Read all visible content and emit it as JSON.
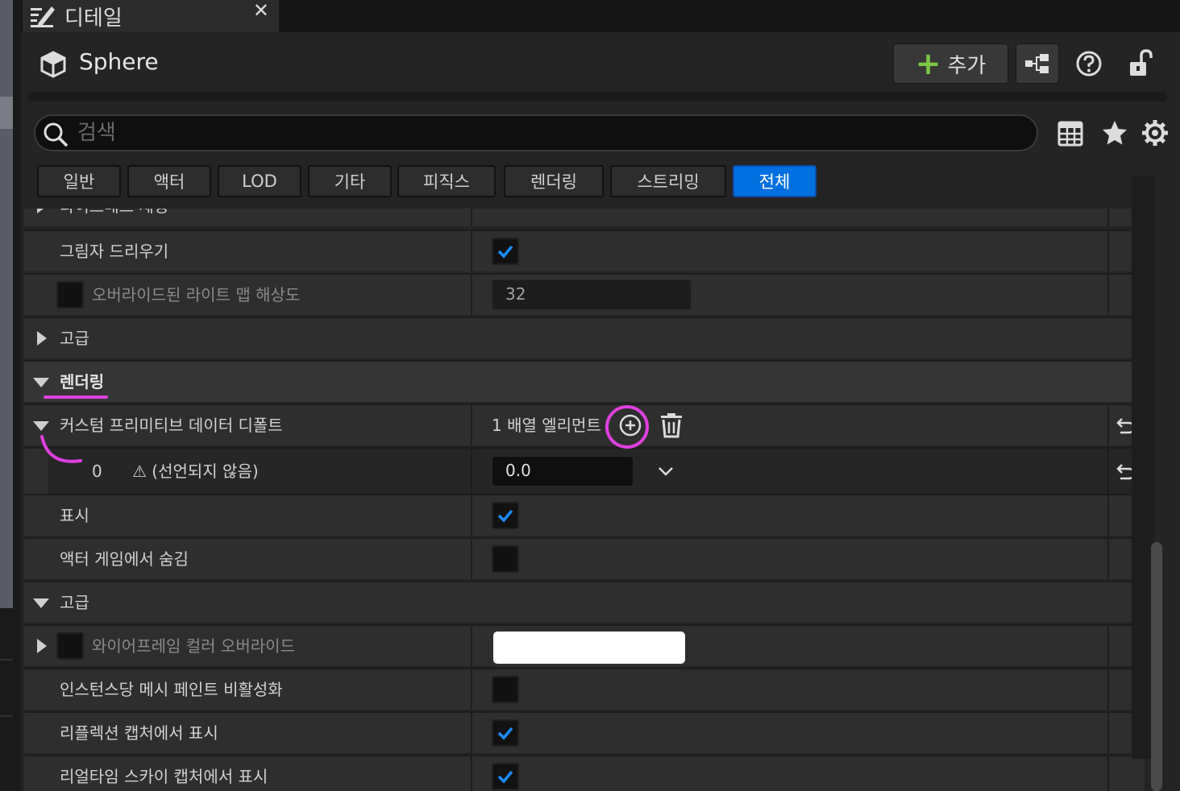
{
  "tab": {
    "title": "디테일",
    "close": "✕",
    "icon": "pencil-icon"
  },
  "header": {
    "object_name": "Sphere",
    "add_label": "추가",
    "icons": [
      "cube-icon",
      "blueprint-icon",
      "help-icon",
      "unlock-icon"
    ]
  },
  "search": {
    "placeholder": "검색",
    "value": ""
  },
  "toolbar_icons": [
    "grid-icon",
    "star-icon",
    "gear-icon"
  ],
  "filters": [
    {
      "label": "일반",
      "active": false
    },
    {
      "label": "액터",
      "active": false
    },
    {
      "label": "LOD",
      "active": false
    },
    {
      "label": "기타",
      "active": false
    },
    {
      "label": "피직스",
      "active": false
    },
    {
      "label": "렌더링",
      "active": false
    },
    {
      "label": "스트리밍",
      "active": false
    },
    {
      "label": "전체",
      "active": true
    }
  ],
  "rows": {
    "cut": "라이트매스 세팅",
    "cast_shadow": {
      "label": "그림자 드리우기",
      "checked": true
    },
    "override_lightmap": {
      "label": "오버라이드된 라이트 맵 해상도",
      "value": "32",
      "enabled": false
    },
    "advanced1": "고급",
    "rendering": "렌더링",
    "custom_primitive": {
      "label": "커스텀 프리미티브 데이터 디폴트",
      "value": "1 배열 엘리먼트"
    },
    "element0": {
      "index": "0",
      "warning": "⚠ (선언되지 않음)",
      "value": "0.0"
    },
    "visible": {
      "label": "표시",
      "checked": true
    },
    "hidden_in_game": {
      "label": "액터 게임에서 숨김",
      "checked": false
    },
    "advanced2": "고급",
    "wireframe_color": {
      "label": "와이어프레임 컬러 오버라이드",
      "color": "#ffffff",
      "enabled": false
    },
    "disable_mesh_paint": {
      "label": "인스턴스당 메시 페인트 비활성화",
      "checked": false
    },
    "reflection_capture": {
      "label": "리플렉션 캡처에서 표시",
      "checked": true
    },
    "sky_capture": {
      "label": "리얼타임 스카이 캡처에서 표시",
      "checked": true
    }
  },
  "colors": {
    "accent": "#0070e0",
    "annotation": "#e040e0",
    "plus": "#7bc943",
    "check": "#1a8cff"
  }
}
